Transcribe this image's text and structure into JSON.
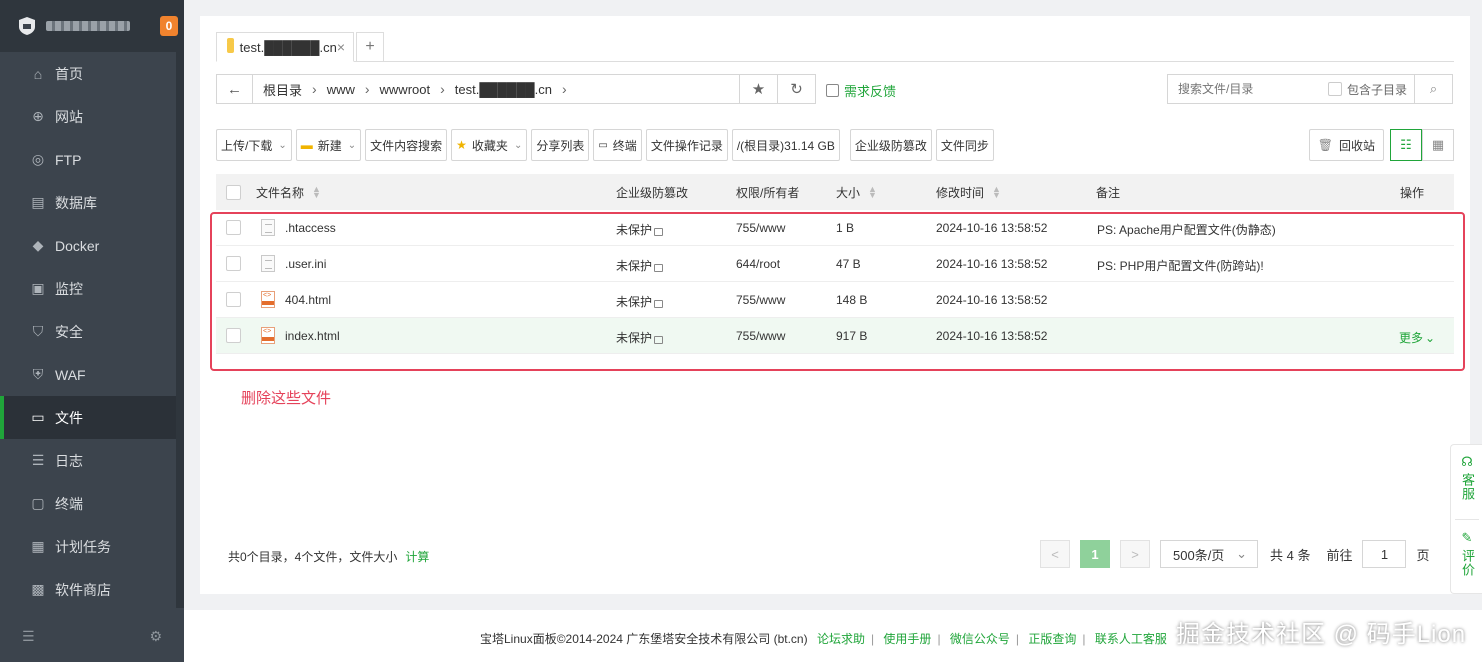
{
  "sidebar": {
    "badge": "0",
    "items": [
      {
        "label": "首页",
        "icon": "home-icon"
      },
      {
        "label": "网站",
        "icon": "globe-icon"
      },
      {
        "label": "FTP",
        "icon": "ftp-icon"
      },
      {
        "label": "数据库",
        "icon": "database-icon"
      },
      {
        "label": "Docker",
        "icon": "docker-icon"
      },
      {
        "label": "监控",
        "icon": "monitor-icon"
      },
      {
        "label": "安全",
        "icon": "shield-icon"
      },
      {
        "label": "WAF",
        "icon": "waf-icon"
      },
      {
        "label": "文件",
        "icon": "folder-icon",
        "active": true
      },
      {
        "label": "日志",
        "icon": "log-icon"
      },
      {
        "label": "终端",
        "icon": "terminal-icon"
      },
      {
        "label": "计划任务",
        "icon": "calendar-icon"
      },
      {
        "label": "软件商店",
        "icon": "grid-icon"
      }
    ]
  },
  "tabs": {
    "active": "test.██████.cn",
    "close": "×",
    "add": "+"
  },
  "address": {
    "back": "←",
    "crumbs": [
      "根目录",
      "www",
      "wwwroot",
      "test.██████.cn"
    ],
    "feedback": "需求反馈"
  },
  "search": {
    "placeholder": "搜索文件/目录",
    "subdir_label": "包含子目录"
  },
  "toolbar": {
    "upload": "上传/下载",
    "new": "新建",
    "content_search": "文件内容搜索",
    "favorites": "收藏夹",
    "share_list": "分享列表",
    "terminal": "终端",
    "op_log": "文件操作记录",
    "disk": "/(根目录)31.14 GB",
    "tamper": "企业级防篡改",
    "sync": "文件同步",
    "recycle": "回收站"
  },
  "table": {
    "headers": {
      "name": "文件名称",
      "tamper": "企业级防篡改",
      "perm": "权限/所有者",
      "size": "大小",
      "mtime": "修改时间",
      "note": "备注",
      "ops": "操作"
    },
    "rows": [
      {
        "name": ".htaccess",
        "type": "txt",
        "tamper": "未保护",
        "perm": "755/www",
        "size": "1 B",
        "mtime": "2024-10-16 13:58:52",
        "note": "PS: Apache用户配置文件(伪静态)",
        "op": ""
      },
      {
        "name": ".user.ini",
        "type": "txt",
        "tamper": "未保护",
        "perm": "644/root",
        "size": "47 B",
        "mtime": "2024-10-16 13:58:52",
        "note": "PS: PHP用户配置文件(防跨站)!",
        "op": ""
      },
      {
        "name": "404.html",
        "type": "html",
        "tamper": "未保护",
        "perm": "755/www",
        "size": "148 B",
        "mtime": "2024-10-16 13:58:52",
        "note": "",
        "op": ""
      },
      {
        "name": "index.html",
        "type": "html",
        "tamper": "未保护",
        "perm": "755/www",
        "size": "917 B",
        "mtime": "2024-10-16 13:58:52",
        "note": "",
        "op": "更多"
      }
    ]
  },
  "annotation": "删除这些文件",
  "footer_info": {
    "summary": "共0个目录，4个文件，文件大小",
    "calc": "计算"
  },
  "pager": {
    "prev": "<",
    "page": "1",
    "next": ">",
    "per_page": "500条/页",
    "total": "共 4 条",
    "goto": "前往",
    "goto_value": "1",
    "page_unit": "页"
  },
  "float": {
    "service": "客服",
    "review": "评价"
  },
  "copyright": {
    "text": "宝塔Linux面板©2014-2024 广东堡塔安全技术有限公司 (bt.cn)",
    "links": [
      "论坛求助",
      "使用手册",
      "微信公众号",
      "正版查询",
      "联系人工客服"
    ]
  },
  "watermark": "掘金技术社区 @ 码手Lion",
  "colors": {
    "accent": "#20a53a",
    "annotation": "#e5425a",
    "sidebar": "#3c444d"
  }
}
